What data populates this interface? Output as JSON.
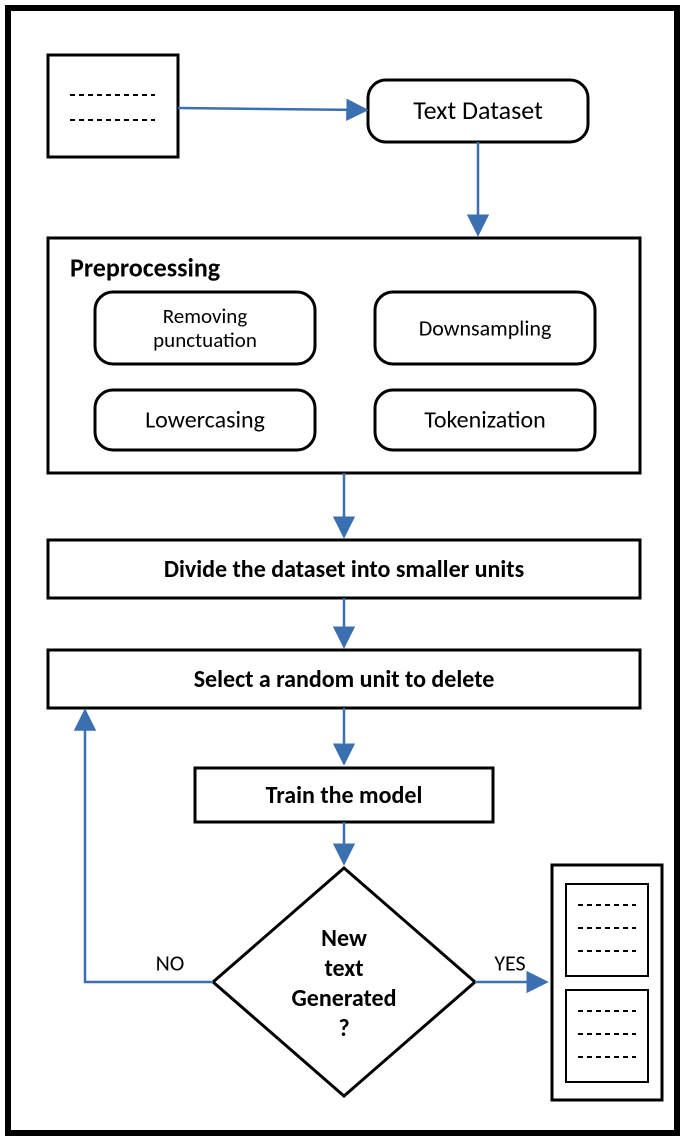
{
  "nodes": {
    "text_dataset": "Text Dataset",
    "preprocessing_title": "Preprocessing",
    "removing_punctuation_l1": "Removing",
    "removing_punctuation_l2": "punctuation",
    "downsampling": "Downsampling",
    "lowercasing": "Lowercasing",
    "tokenization": "Tokenization",
    "divide": "Divide the dataset into smaller units",
    "select_random": "Select a random unit to delete",
    "train": "Train the model",
    "decision_l1": "New",
    "decision_l2": "text",
    "decision_l3": "Generated",
    "decision_l4": "?"
  },
  "labels": {
    "no": "NO",
    "yes": "YES"
  },
  "chart_data": {
    "type": "flowchart",
    "nodes": [
      {
        "id": "input",
        "type": "document",
        "label": "(raw text lines)"
      },
      {
        "id": "text_dataset",
        "type": "process",
        "label": "Text Dataset"
      },
      {
        "id": "preprocessing",
        "type": "container",
        "label": "Preprocessing",
        "children": [
          "Removing punctuation",
          "Downsampling",
          "Lowercasing",
          "Tokenization"
        ]
      },
      {
        "id": "divide",
        "type": "process",
        "label": "Divide the dataset into smaller units"
      },
      {
        "id": "select",
        "type": "process",
        "label": "Select a random unit to delete"
      },
      {
        "id": "train",
        "type": "process",
        "label": "Train the model"
      },
      {
        "id": "decision",
        "type": "decision",
        "label": "New text Generated ?"
      },
      {
        "id": "output",
        "type": "document-stack",
        "label": "(generated text documents)"
      }
    ],
    "edges": [
      {
        "from": "input",
        "to": "text_dataset"
      },
      {
        "from": "text_dataset",
        "to": "preprocessing"
      },
      {
        "from": "preprocessing",
        "to": "divide"
      },
      {
        "from": "divide",
        "to": "select"
      },
      {
        "from": "select",
        "to": "train"
      },
      {
        "from": "train",
        "to": "decision"
      },
      {
        "from": "decision",
        "to": "output",
        "label": "YES"
      },
      {
        "from": "decision",
        "to": "select",
        "label": "NO"
      }
    ]
  }
}
